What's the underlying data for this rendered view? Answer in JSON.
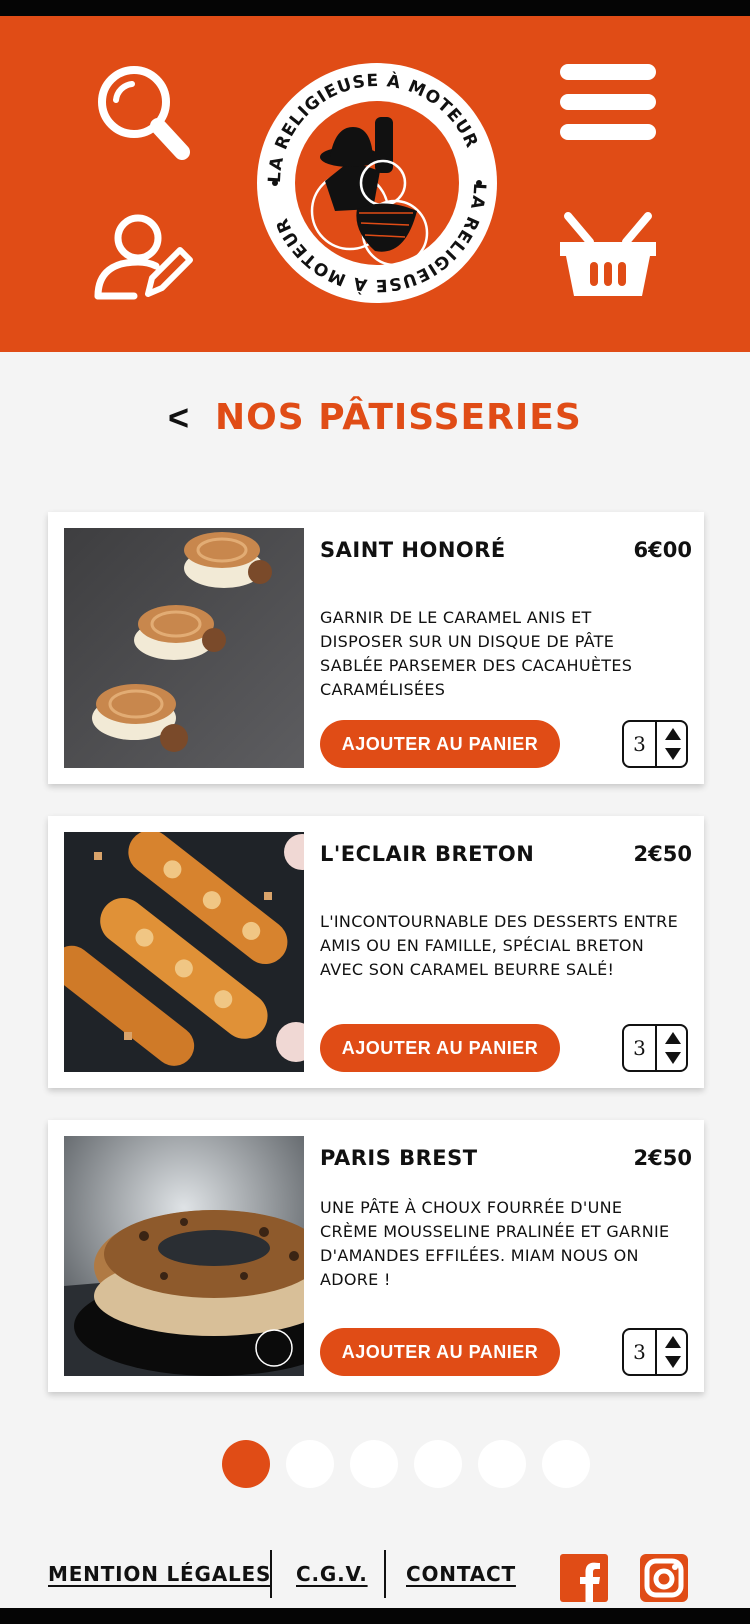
{
  "header": {
    "logo_text": "LA RELIGIEUSE À MOTEUR",
    "icons": [
      "search-icon",
      "account-edit-icon",
      "menu-icon",
      "cart-icon"
    ]
  },
  "page": {
    "back_label": "<",
    "title": "NOS PÂTISSERIES"
  },
  "products": [
    {
      "name": "SAINT HONORÉ",
      "price": "6€00",
      "description": "GARNIR DE LE CARAMEL ANIS ET DISPOSER SUR UN DISQUE DE PÂTE SABLÉE PARSEMER DES CACAHUÈTES CARAMÉLISÉES",
      "add_label": "AJOUTER AU PANIER",
      "quantity": "3"
    },
    {
      "name": "L'ECLAIR BRETON",
      "price": "2€50",
      "description": "L'INCONTOURNABLE DES DESSERTS ENTRE AMIS OU EN FAMILLE, SPÉCIAL BRETON AVEC SON CARAMEL BEURRE SALÉ!",
      "add_label": "AJOUTER AU PANIER",
      "quantity": "3"
    },
    {
      "name": "PARIS BREST",
      "price": "2€50",
      "description": "UNE PÂTE À CHOUX FOURRÉE D'UNE CRÈME MOUSSELINE PRALINÉE ET GARNIE D'AMANDES EFFILÉES. MIAM NOUS ON ADORE !",
      "add_label": "AJOUTER AU PANIER",
      "quantity": "3"
    }
  ],
  "pagination": {
    "pages": 6,
    "current": 1
  },
  "footer": {
    "links": [
      "MENTION LÉGALES",
      "C.G.V.",
      "CONTACT"
    ],
    "social": [
      "facebook-icon",
      "instagram-icon"
    ]
  },
  "colors": {
    "accent": "#e04c16",
    "background": "#f4f4f4",
    "text": "#111111"
  }
}
